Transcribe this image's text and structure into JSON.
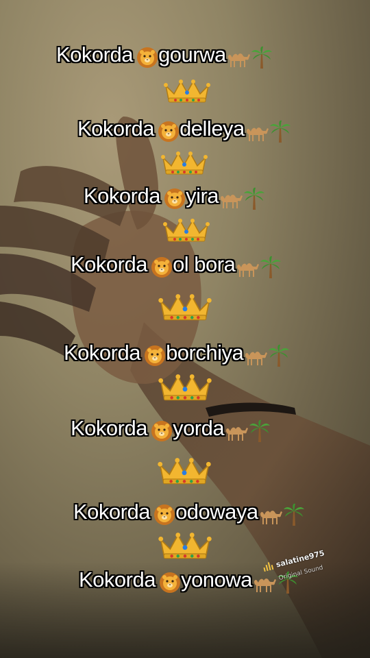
{
  "lines": [
    {
      "prefix": "Kokorda",
      "suffix": "gourwa"
    },
    {
      "prefix": "Kokorda",
      "suffix": "delleya"
    },
    {
      "prefix": "Kokorda",
      "suffix": "yira"
    },
    {
      "prefix": "Kokorda",
      "suffix": "ol bora"
    },
    {
      "prefix": "Kokorda",
      "suffix": "borchiya"
    },
    {
      "prefix": "Kokorda",
      "suffix": "yorda"
    },
    {
      "prefix": "Kokorda",
      "suffix": "odowaya"
    },
    {
      "prefix": "Kokorda",
      "suffix": "yonowa"
    }
  ],
  "icons": {
    "lion": "lion-face-icon",
    "camel": "camel-icon",
    "palm": "palm-tree-icon",
    "crown": "crown-icon"
  },
  "sound": {
    "username": "salatine975",
    "label": "Original Sound"
  },
  "colors": {
    "text": "#ffffff",
    "outline": "#000000",
    "gold": "#e0a623"
  }
}
